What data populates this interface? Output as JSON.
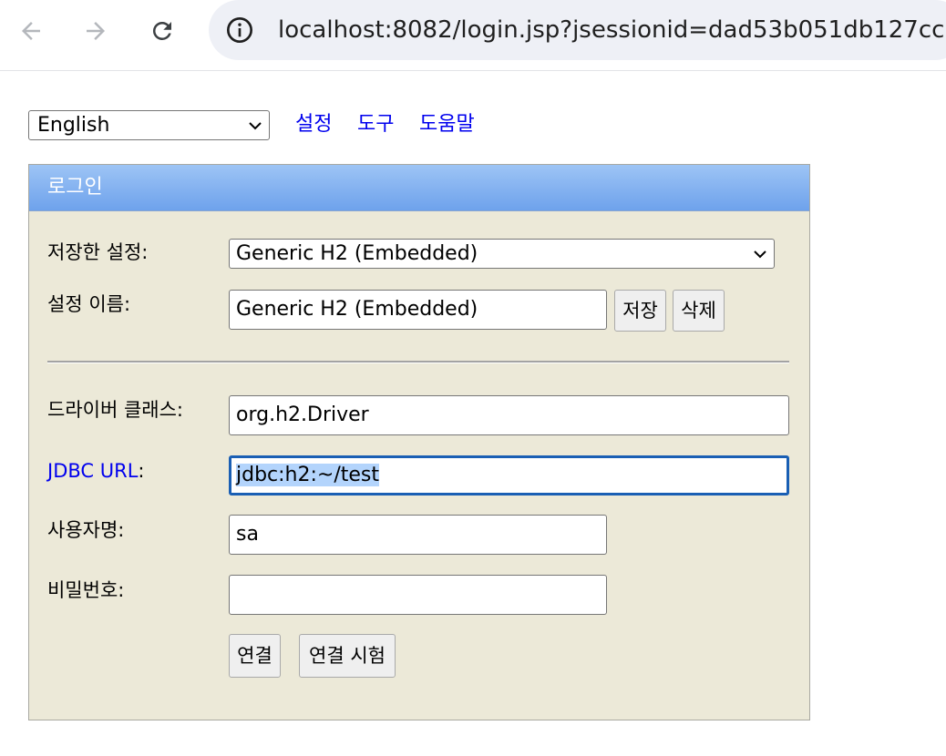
{
  "browser": {
    "url": "localhost:8082/login.jsp?jsessionid=dad53b051db127cc"
  },
  "top": {
    "language_value": "English",
    "links": [
      "설정",
      "도구",
      "도움말"
    ]
  },
  "login": {
    "title": "로그인",
    "saved_settings_label": "저장한 설정:",
    "saved_settings_value": "Generic H2 (Embedded)",
    "setting_name_label": "설정 이름:",
    "setting_name_value": "Generic H2 (Embedded)",
    "save_button": "저장",
    "delete_button": "삭제",
    "driver_label": "드라이버 클래스:",
    "driver_value": "org.h2.Driver",
    "jdbc_link": "JDBC URL",
    "jdbc_colon": ":",
    "jdbc_value": "jdbc:h2:~/test",
    "user_label": "사용자명:",
    "user_value": "sa",
    "password_label": "비밀번호:",
    "password_value": "",
    "connect_button": "연결",
    "test_button": "연결 시험"
  },
  "colors": {
    "accent_link": "#0000ee",
    "panel_bg": "#ece9d8",
    "header_blue": "#6ea2ec",
    "focus_border": "#1a5fb4",
    "selection": "#b3d4fc"
  },
  "icons": [
    "back-arrow-icon",
    "forward-arrow-icon",
    "reload-icon",
    "site-info-icon",
    "chevron-down-icon"
  ]
}
